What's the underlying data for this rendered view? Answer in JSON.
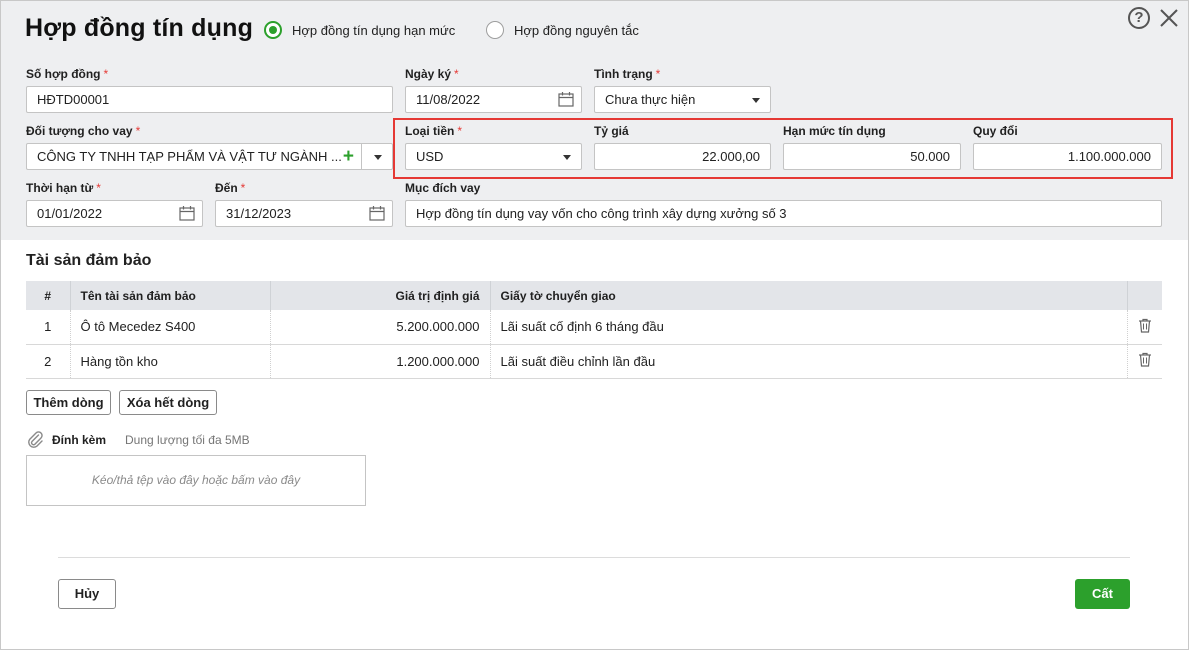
{
  "dialog": {
    "title": "Hợp đồng tín dụng",
    "radio_options": [
      {
        "label": "Hợp đồng tín dụng hạn mức",
        "selected": true
      },
      {
        "label": "Hợp đồng nguyên tắc",
        "selected": false
      }
    ],
    "help_label": "?"
  },
  "form": {
    "contract_no": {
      "label": "Số hợp đồng",
      "required": "*",
      "value": "HĐTD00001"
    },
    "sign_date": {
      "label": "Ngày ký",
      "required": "*",
      "value": "11/08/2022"
    },
    "status": {
      "label": "Tình trạng",
      "required": "*",
      "value": "Chưa thực hiện"
    },
    "borrower": {
      "label": "Đối tượng cho vay",
      "required": "*",
      "value": "CÔNG TY TNHH TẠP PHẨM VÀ VẬT TƯ NGÀNH ...",
      "add_label": "+"
    },
    "currency": {
      "label": "Loại tiền",
      "required": "*",
      "value": "USD"
    },
    "exchange_rate": {
      "label": "Tỷ giá",
      "value": "22.000,00"
    },
    "credit_limit": {
      "label": "Hạn mức tín dụng",
      "value": "50.000"
    },
    "converted": {
      "label": "Quy đổi",
      "value": "1.100.000.000"
    },
    "term_from": {
      "label": "Thời hạn từ",
      "required": "*",
      "value": "01/01/2022"
    },
    "term_to": {
      "label": "Đến",
      "required": "*",
      "value": "31/12/2023"
    },
    "purpose": {
      "label": "Mục đích vay",
      "value": "Hợp đồng tín dụng vay vốn cho công trình xây dựng xưởng số 3"
    }
  },
  "collateral": {
    "title": "Tài sản đảm bảo",
    "columns": [
      "#",
      "Tên tài sản đảm bảo",
      "Giá trị định giá",
      "Giấy tờ chuyển giao"
    ],
    "rows": [
      {
        "no": "1",
        "name": "Ô tô Mecedez S400",
        "value": "5.200.000.000",
        "docs": "Lãi suất cố định 6 tháng đầu"
      },
      {
        "no": "2",
        "name": "Hàng tồn kho",
        "value": "1.200.000.000",
        "docs": "Lãi suất điều chỉnh lần đầu"
      }
    ],
    "add_row_label": "Thêm dòng",
    "clear_rows_label": "Xóa hết dòng"
  },
  "attachment": {
    "label": "Đính kèm",
    "hint": "Dung lượng tối đa 5MB",
    "drop_text": "Kéo/thả tệp vào đây hoặc bấm vào đây"
  },
  "footer": {
    "cancel_label": "Hủy",
    "save_label": "Cất"
  },
  "colors": {
    "accent": "#2ca02c",
    "required": "#e53935",
    "highlight": "#e53935"
  }
}
